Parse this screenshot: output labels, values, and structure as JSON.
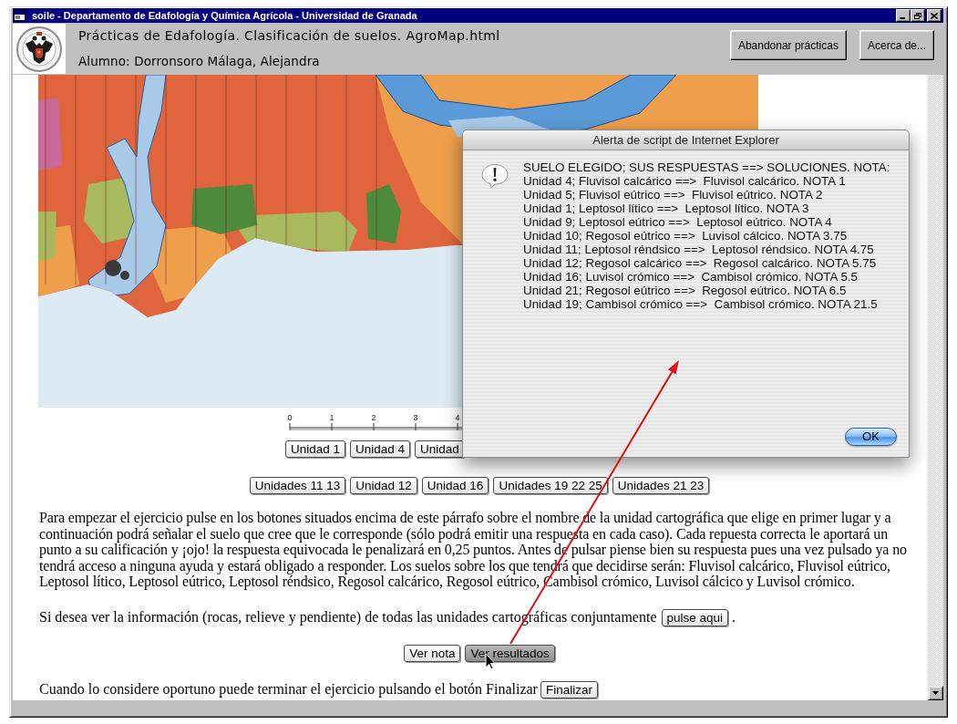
{
  "window": {
    "title": "soile - Departamento de Edafología y Química Agrícola - Universidad de Granada"
  },
  "header": {
    "title": "Prácticas de Edafología. Clasificación de suelos. AgroMap.html",
    "student": "Alumno: Dorronsoro Málaga, Alejandra",
    "buttons": [
      "Abandonar prácticas",
      "Acerca de..."
    ]
  },
  "page": {
    "scale_labels": [
      "0",
      "1",
      "2",
      "3",
      "4"
    ],
    "unit_buttons_top": [
      "Unidad 1",
      "Unidad 4",
      "Unidad"
    ],
    "unit_buttons_bottom": [
      "Unidades 11 13",
      "Unidad 12",
      "Unidad 16",
      "Unidades 19 22 25",
      "Unidades 21 23"
    ],
    "instructions": "Para empezar el ejercicio pulse en los botones situados encima de este párrafo sobre el nombre de la unidad cartográfica que elige en primer lugar y a continuación podrá señalar el suelo que cree que le corresponde (sólo podrá emitir una respuesta en cada caso). Cada repuesta correcta le aportará un punto a su calificación y ¡ojo! la respuesta equivocada le penalizará en 0,25 puntos. Antes de pulsar piense bien su respuesta pues una vez pulsado ya no tendrá acceso a ninguna ayuda y estará obligado a responder. Los suelos sobre los que tendrá que decidirse serán: Fluvisol calcárico, Fluvisol eútrico, Leptosol lítico, Leptosol eútrico, Leptosol réndsico, Regosol calcárico, Regosol eútrico, Cambisol crómico, Luvisol cálcico y Luvisol crómico.",
    "info_text": "Si desea ver la información (rocas, relieve y pendiente) de todas las unidades cartográficas conjuntamente",
    "info_button": "pulse aqui",
    "info_end": ".",
    "result_buttons": [
      {
        "label": "Ver nota",
        "selected": false
      },
      {
        "label": "Ver resultados",
        "selected": true
      }
    ],
    "finish_text": "Cuando lo considere oportuno puede terminar el ejercicio pulsando el botón Finalizar",
    "finish_button": "Finalizar"
  },
  "alert": {
    "title": "Alerta de script de Internet Explorer",
    "lines": [
      "SUELO ELEGIDO; SUS RESPUESTAS ==> SOLUCIONES. NOTA:",
      "Unidad 4; Fluvisol calcárico ==>  Fluvisol calcárico. NOTA 1",
      "Unidad 5; Fluvisol eútrico ==>  Fluvisol eútrico. NOTA 2",
      "Unidad 1; Leptosol lítico ==>  Leptosol lítico. NOTA 3",
      "Unidad 9; Leptosol eútrico ==>  Leptosol eútrico. NOTA 4",
      "Unidad 10; Regosol eútrico ==>  Luvisol cálcico. NOTA 3.75",
      "Unidad 11; Leptosol réndsico ==>  Leptosol réndsico. NOTA 4.75",
      "Unidad 12; Regosol calcárico ==>  Regosol calcárico. NOTA 5.75",
      "Unidad 16; Luvisol crómico ==>  Cambisol crómico. NOTA 5.5",
      "Unidad 21; Regosol eútrico ==>  Regosol eútrico. NOTA 6.5",
      "Unidad 19; Cambisol crómico ==>  Cambisol crómico. NOTA 21.5"
    ],
    "button": "OK"
  }
}
